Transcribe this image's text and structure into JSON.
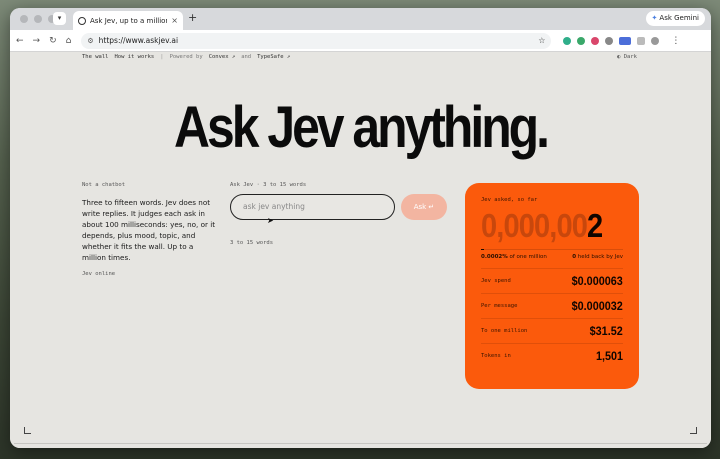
{
  "browser": {
    "tab_title": "Ask Jev, up to a million times",
    "url": "https://www.askjev.ai",
    "new_tab": "+",
    "gemini_label": "Ask Gemini",
    "close": "×"
  },
  "page": {
    "nav": {
      "wall": "The wall",
      "how": "How it works",
      "divider": "|",
      "powered_by": "Powered by",
      "convex": "Convex ↗",
      "and": "and",
      "typesafe": "TypeSafe ↗",
      "dark": "◐ Dark"
    },
    "hero": "Ask Jev anything.",
    "intro": {
      "label": "Not a chatbot",
      "description": "Three to fifteen words. Jev does not write replies. It judges each ask in about 100 milliseconds: yes, no, or it depends, plus mood, topic, and whether it fits the wall. Up to a million times.",
      "status": "Jev online"
    },
    "ask": {
      "label": "Ask Jev · 3 to 15 words",
      "placeholder": "ask jev anything",
      "button": "Ask ↵",
      "hint": "3 to 15 words"
    },
    "card": {
      "label": "Jev asked, so far",
      "counter_dim": "0,000,00",
      "counter_on": "2",
      "progress_fraction": 2e-06,
      "pct_value": "0.0002%",
      "pct_suffix": "of one million",
      "held_value": "0",
      "held_suffix": "held back by Jev",
      "rows": [
        {
          "k": "Jev spend",
          "v": "$0.000063"
        },
        {
          "k": "Per message",
          "v": "$0.000032"
        },
        {
          "k": "To one million",
          "v": "$31.52"
        },
        {
          "k": "Tokens in",
          "v": "1,501"
        }
      ],
      "accent": "#fb5a0c"
    }
  }
}
